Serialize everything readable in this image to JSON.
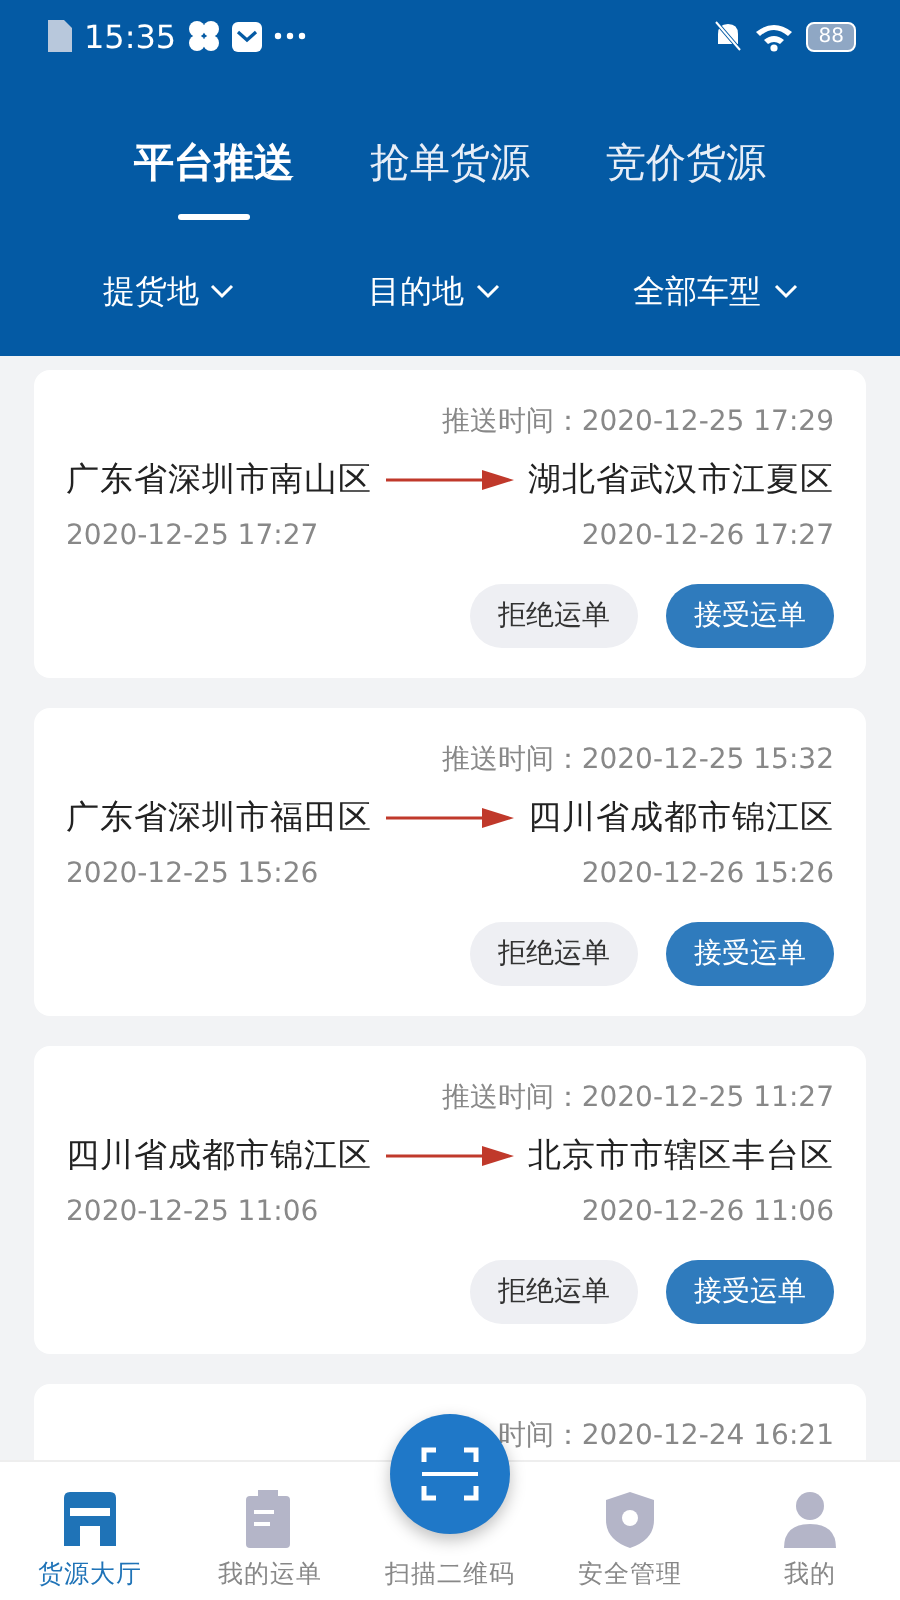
{
  "status_bar": {
    "time": "15:35",
    "battery": "88"
  },
  "tabs": [
    {
      "label": "平台推送",
      "selected": true
    },
    {
      "label": "抢单货源",
      "selected": false
    },
    {
      "label": "竞价货源",
      "selected": false
    }
  ],
  "filters": [
    "提货地",
    "目的地",
    "全部车型"
  ],
  "orders": [
    {
      "push_time": "推送时间：2020-12-25 17:29",
      "from": "广东省深圳市南山区",
      "to": "湖北省武汉市江夏区",
      "from_date": "2020-12-25 17:27",
      "to_date": "2020-12-26 17:27",
      "reject": "拒绝运单",
      "accept": "接受运单"
    },
    {
      "push_time": "推送时间：2020-12-25 15:32",
      "from": "广东省深圳市福田区",
      "to": "四川省成都市锦江区",
      "from_date": "2020-12-25 15:26",
      "to_date": "2020-12-26 15:26",
      "reject": "拒绝运单",
      "accept": "接受运单"
    },
    {
      "push_time": "推送时间：2020-12-25 11:27",
      "from": "四川省成都市锦江区",
      "to": "北京市市辖区丰台区",
      "from_date": "2020-12-25 11:06",
      "to_date": "2020-12-26 11:06",
      "reject": "拒绝运单",
      "accept": "接受运单"
    },
    {
      "push_time": "时间：2020-12-24 16:21"
    }
  ],
  "nav": [
    {
      "label": "货源大厅",
      "kind": "store",
      "selected": true
    },
    {
      "label": "我的运单",
      "kind": "clipboard",
      "selected": false
    },
    {
      "label": "扫描二维码",
      "kind": "scan",
      "selected": false
    },
    {
      "label": "安全管理",
      "kind": "shield",
      "selected": false
    },
    {
      "label": "我的",
      "kind": "person",
      "selected": false
    }
  ]
}
